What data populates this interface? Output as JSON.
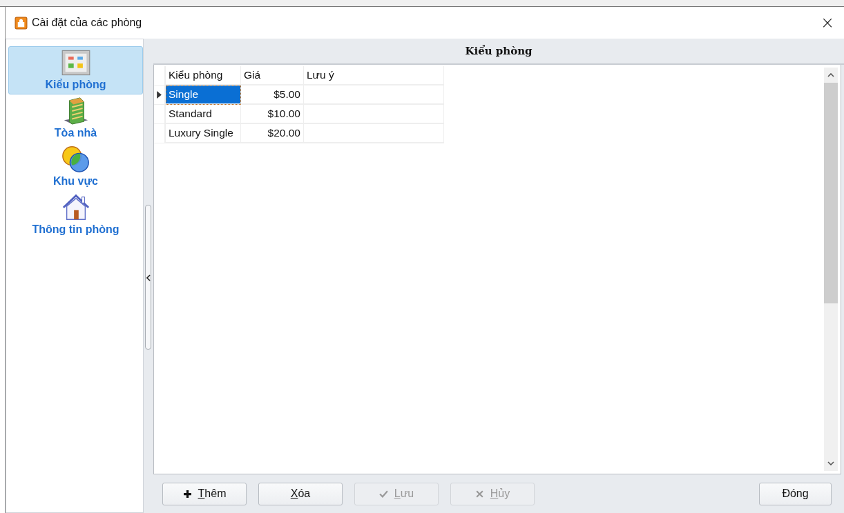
{
  "window": {
    "title": "Cài đặt của các phòng",
    "close": "×"
  },
  "sidebar": {
    "items": [
      {
        "label": "Kiểu phòng",
        "kind": "room-type",
        "selected": true
      },
      {
        "label": "Tòa nhà",
        "kind": "building",
        "selected": false
      },
      {
        "label": "Khu vực",
        "kind": "area",
        "selected": false
      },
      {
        "label": "Thông tin phòng",
        "kind": "room-info",
        "selected": false
      }
    ]
  },
  "panel": {
    "title": "Kiểu phòng"
  },
  "table": {
    "columns": [
      "Kiểu phòng",
      "Giá",
      "Lưu ý"
    ],
    "rows": [
      {
        "cells": [
          "Single",
          "$5.00",
          ""
        ],
        "selected": true
      },
      {
        "cells": [
          "Standard",
          "$10.00",
          ""
        ],
        "selected": false
      },
      {
        "cells": [
          "Luxury Single",
          "$20.00",
          ""
        ],
        "selected": false
      }
    ]
  },
  "buttons": [
    {
      "label": "Thêm",
      "kind": "add",
      "disabled": false
    },
    {
      "label": "Xóa",
      "kind": "delete",
      "disabled": false
    },
    {
      "label": "Lưu",
      "kind": "save",
      "disabled": true
    },
    {
      "label": "Hủy",
      "kind": "cancel",
      "disabled": true
    },
    {
      "label": "Đóng",
      "kind": "close",
      "disabled": false
    }
  ]
}
